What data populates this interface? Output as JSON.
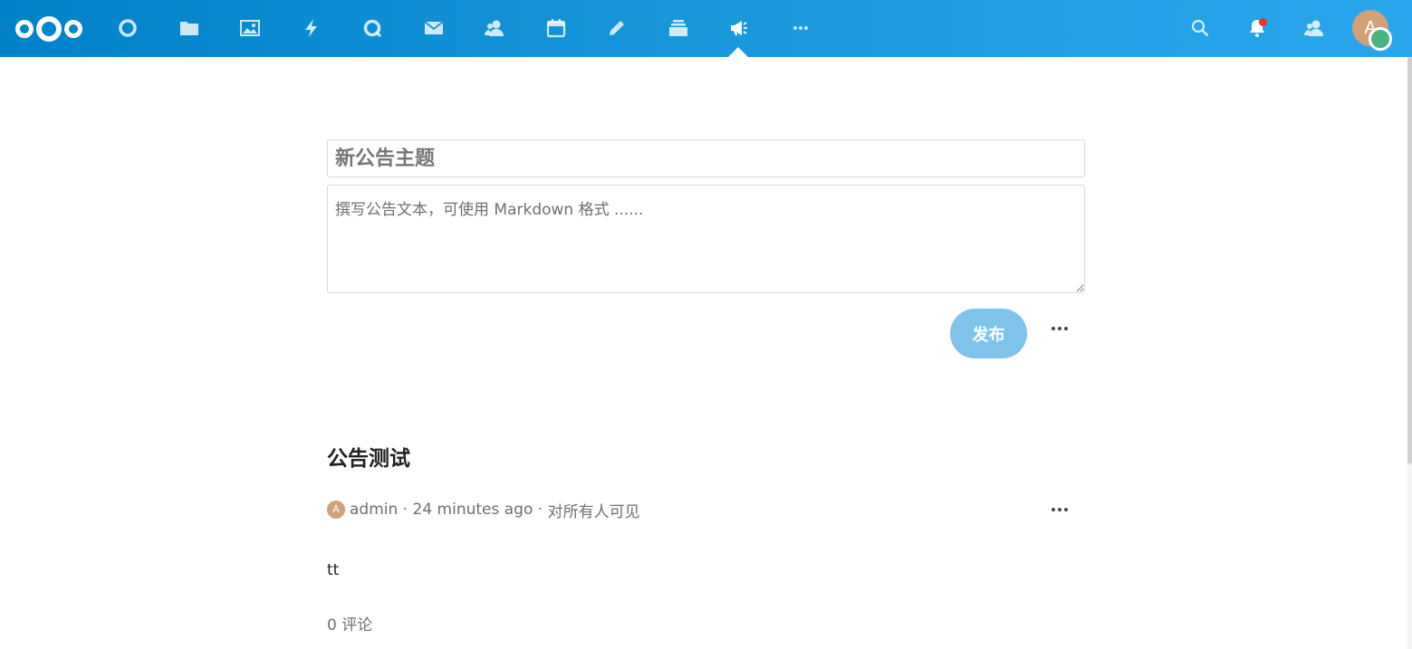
{
  "header": {
    "apps": [
      {
        "name": "dashboard-icon"
      },
      {
        "name": "files-icon"
      },
      {
        "name": "photos-icon"
      },
      {
        "name": "activity-icon"
      },
      {
        "name": "talk-icon"
      },
      {
        "name": "mail-icon"
      },
      {
        "name": "contacts-icon"
      },
      {
        "name": "calendar-icon"
      },
      {
        "name": "notes-icon"
      },
      {
        "name": "deck-icon"
      },
      {
        "name": "announcements-icon",
        "active": true
      },
      {
        "name": "more-apps-icon"
      }
    ],
    "right_icons": [
      "search-icon",
      "notifications-icon",
      "contacts-menu-icon"
    ],
    "avatar_letter": "A",
    "colors": {
      "bar_start": "#0082c9",
      "bar_end": "#2aa6ee",
      "status_online": "#49b382",
      "notification": "#e9322d"
    }
  },
  "editor": {
    "title_placeholder": "新公告主题",
    "body_placeholder": "撰写公告文本，可使用 Markdown 格式 ......",
    "publish_label": "发布"
  },
  "announcement": {
    "title": "公告测试",
    "avatar_letter": "A",
    "author": "admin",
    "separator1": " · ",
    "time": "24 minutes ago",
    "separator2": " · ",
    "visibility": "对所有人可见",
    "body": "tt",
    "comments": "0 评论"
  }
}
